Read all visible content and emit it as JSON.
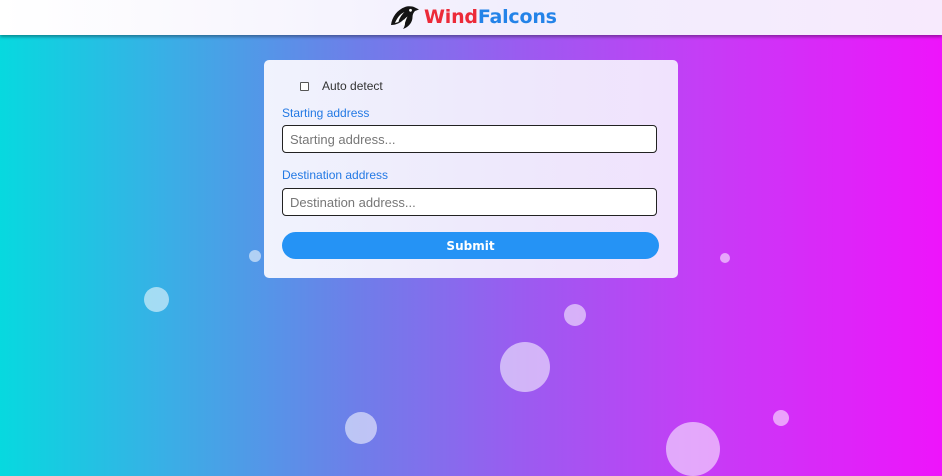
{
  "brand": {
    "name_part1": "Wind",
    "name_part2": "Falcons",
    "logo_icon": "falcon-head-icon",
    "color_part1": "#ec2a38",
    "color_part2": "#2483e8"
  },
  "form": {
    "auto_detect_label": "Auto detect",
    "auto_detect_checked": false,
    "starting_label": "Starting address",
    "starting_placeholder": "Starting address...",
    "starting_value": "",
    "destination_label": "Destination address",
    "destination_placeholder": "Destination address...",
    "destination_value": "",
    "submit_label": "Submit",
    "submit_color": "#2593f5"
  },
  "background": {
    "gradient_start": "#07d9df",
    "gradient_end": "#ee14fb",
    "decoration": "floating-bubbles"
  }
}
